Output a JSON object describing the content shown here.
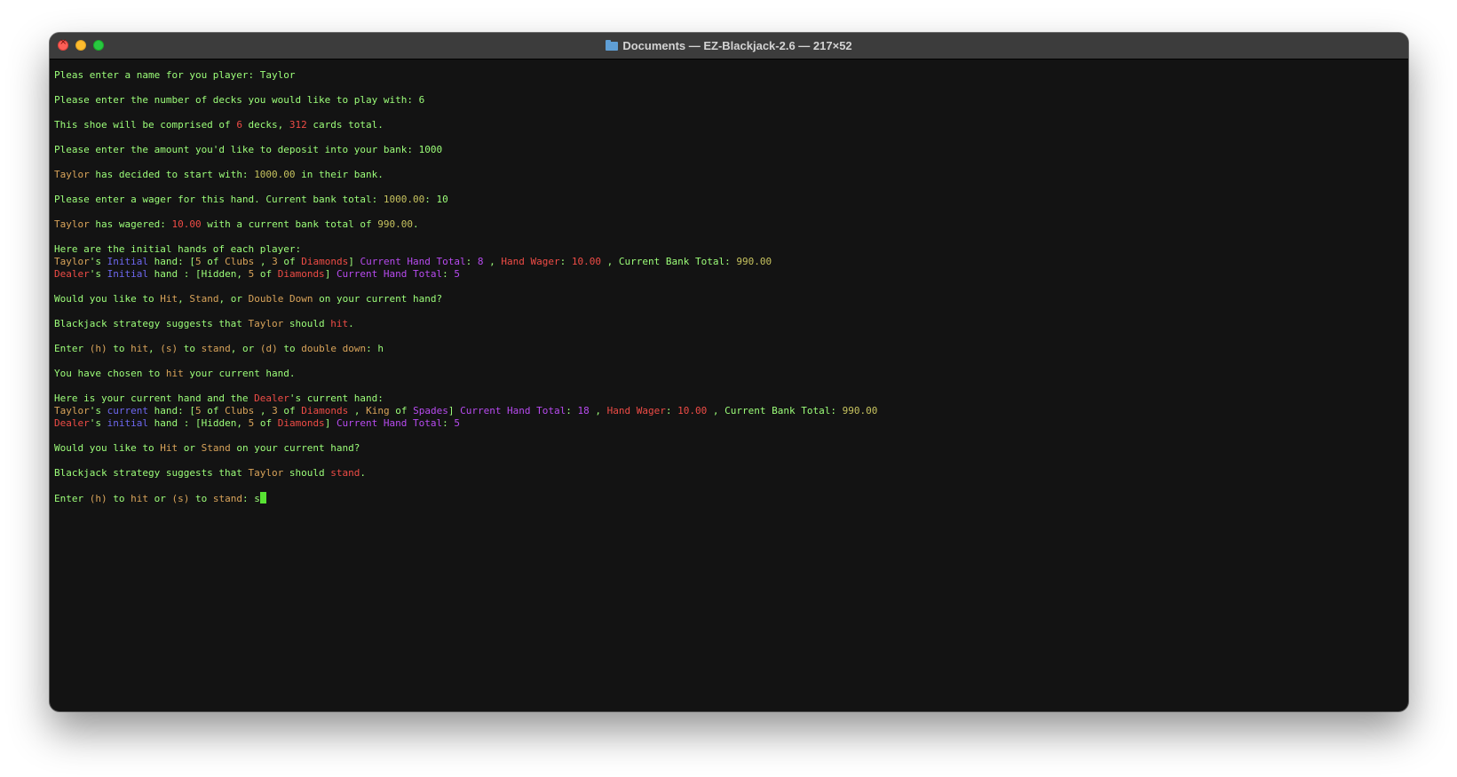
{
  "window": {
    "title": "Documents — EZ-Blackjack-2.6 — 217×52"
  },
  "colors": {
    "default": "#9dff7a",
    "orange": "#d9a45a",
    "red": "#ef4c46",
    "purple": "#b84bf0",
    "blue": "#6e68f0",
    "gold": "#c7c35f",
    "cursor": "#58e233"
  },
  "terminal": {
    "lines": [
      [
        [
          "Pleas enter a name for you player: Taylor",
          "default"
        ]
      ],
      [],
      [
        [
          "Please enter the number of decks you would like to play with: 6",
          "default"
        ]
      ],
      [],
      [
        [
          "This shoe will be comprised of ",
          "default"
        ],
        [
          "6",
          "red"
        ],
        [
          " decks, ",
          "default"
        ],
        [
          "312",
          "red"
        ],
        [
          " cards total.",
          "default"
        ]
      ],
      [],
      [
        [
          "Please enter the amount you'd like to deposit into your bank: 1000",
          "default"
        ]
      ],
      [],
      [
        [
          "Taylor",
          "orange"
        ],
        [
          " has decided to start with: ",
          "default"
        ],
        [
          "1000.00",
          "gold"
        ],
        [
          " in their bank.",
          "default"
        ]
      ],
      [],
      [
        [
          "Please enter a wager for this hand. Current bank total: ",
          "default"
        ],
        [
          "1000.00",
          "gold"
        ],
        [
          ": 10",
          "default"
        ]
      ],
      [],
      [
        [
          "Taylor",
          "orange"
        ],
        [
          " has wagered: ",
          "default"
        ],
        [
          "10.00",
          "red"
        ],
        [
          " with a current bank total of ",
          "default"
        ],
        [
          "990.00",
          "gold"
        ],
        [
          ".",
          "default"
        ]
      ],
      [],
      [
        [
          "Here are the initial hands of each player:",
          "default"
        ]
      ],
      [
        [
          "Taylor",
          "orange"
        ],
        [
          "'s ",
          "default"
        ],
        [
          "Initial",
          "blue"
        ],
        [
          " hand: [",
          "default"
        ],
        [
          "5",
          "orange"
        ],
        [
          " of ",
          "default"
        ],
        [
          "Clubs",
          "orange"
        ],
        [
          " , ",
          "default"
        ],
        [
          "3",
          "orange"
        ],
        [
          " of ",
          "default"
        ],
        [
          "Diamonds",
          "red"
        ],
        [
          "] ",
          "default"
        ],
        [
          "Current Hand Total",
          "purple"
        ],
        [
          ": ",
          "default"
        ],
        [
          "8",
          "purple"
        ],
        [
          " , ",
          "default"
        ],
        [
          "Hand Wager",
          "red"
        ],
        [
          ": ",
          "default"
        ],
        [
          "10.00",
          "red"
        ],
        [
          " , ",
          "default"
        ],
        [
          "Current Bank Total",
          "default"
        ],
        [
          ": ",
          "default"
        ],
        [
          "990.00",
          "gold"
        ]
      ],
      [
        [
          "Dealer",
          "red"
        ],
        [
          "'s ",
          "default"
        ],
        [
          "Initial",
          "blue"
        ],
        [
          " hand : [Hidden, ",
          "default"
        ],
        [
          "5",
          "orange"
        ],
        [
          " of ",
          "default"
        ],
        [
          "Diamonds",
          "red"
        ],
        [
          "] ",
          "default"
        ],
        [
          "Current Hand Total",
          "purple"
        ],
        [
          ": ",
          "default"
        ],
        [
          "5",
          "purple"
        ]
      ],
      [],
      [
        [
          "Would you like to ",
          "default"
        ],
        [
          "Hit",
          "orange"
        ],
        [
          ", ",
          "default"
        ],
        [
          "Stand",
          "orange"
        ],
        [
          ", or ",
          "default"
        ],
        [
          "Double Down",
          "orange"
        ],
        [
          " on your current hand?",
          "default"
        ]
      ],
      [],
      [
        [
          "Blackjack strategy suggests that ",
          "default"
        ],
        [
          "Taylor",
          "orange"
        ],
        [
          " should ",
          "default"
        ],
        [
          "hit",
          "red"
        ],
        [
          ".",
          "default"
        ]
      ],
      [],
      [
        [
          "Enter ",
          "default"
        ],
        [
          "(h)",
          "orange"
        ],
        [
          " to ",
          "default"
        ],
        [
          "hit",
          "orange"
        ],
        [
          ", ",
          "default"
        ],
        [
          "(s)",
          "orange"
        ],
        [
          " to ",
          "default"
        ],
        [
          "stand",
          "orange"
        ],
        [
          ", or ",
          "default"
        ],
        [
          "(d)",
          "orange"
        ],
        [
          " to ",
          "default"
        ],
        [
          "double down",
          "orange"
        ],
        [
          ": h",
          "default"
        ]
      ],
      [],
      [
        [
          "You have chosen to ",
          "default"
        ],
        [
          "hit",
          "orange"
        ],
        [
          " your current hand.",
          "default"
        ]
      ],
      [],
      [
        [
          "Here is your current hand and the ",
          "default"
        ],
        [
          "Dealer",
          "red"
        ],
        [
          "'s current hand:",
          "default"
        ]
      ],
      [
        [
          "Taylor",
          "orange"
        ],
        [
          "'s ",
          "default"
        ],
        [
          "current",
          "blue"
        ],
        [
          " hand: [",
          "default"
        ],
        [
          "5",
          "orange"
        ],
        [
          " of ",
          "default"
        ],
        [
          "Clubs",
          "orange"
        ],
        [
          " , ",
          "default"
        ],
        [
          "3",
          "orange"
        ],
        [
          " of ",
          "default"
        ],
        [
          "Diamonds",
          "red"
        ],
        [
          " , ",
          "default"
        ],
        [
          "King",
          "orange"
        ],
        [
          " of ",
          "default"
        ],
        [
          "Spades",
          "purple"
        ],
        [
          "] ",
          "default"
        ],
        [
          "Current Hand Total",
          "purple"
        ],
        [
          ": ",
          "default"
        ],
        [
          "18",
          "purple"
        ],
        [
          " , ",
          "default"
        ],
        [
          "Hand Wager",
          "red"
        ],
        [
          ": ",
          "default"
        ],
        [
          "10.00",
          "red"
        ],
        [
          " , ",
          "default"
        ],
        [
          "Current Bank Total",
          "default"
        ],
        [
          ": ",
          "default"
        ],
        [
          "990.00",
          "gold"
        ]
      ],
      [
        [
          "Dealer",
          "red"
        ],
        [
          "'s ",
          "default"
        ],
        [
          "initial",
          "blue"
        ],
        [
          " hand : [Hidden, ",
          "default"
        ],
        [
          "5",
          "orange"
        ],
        [
          " of ",
          "default"
        ],
        [
          "Diamonds",
          "red"
        ],
        [
          "] ",
          "default"
        ],
        [
          "Current Hand Total",
          "purple"
        ],
        [
          ": ",
          "default"
        ],
        [
          "5",
          "purple"
        ]
      ],
      [],
      [
        [
          "Would you like to ",
          "default"
        ],
        [
          "Hit",
          "orange"
        ],
        [
          " or ",
          "default"
        ],
        [
          "Stand",
          "orange"
        ],
        [
          " on your current hand?",
          "default"
        ]
      ],
      [],
      [
        [
          "Blackjack strategy suggests that ",
          "default"
        ],
        [
          "Taylor",
          "orange"
        ],
        [
          " should ",
          "default"
        ],
        [
          "stand",
          "red"
        ],
        [
          ".",
          "default"
        ]
      ],
      [],
      [
        [
          "Enter ",
          "default"
        ],
        [
          "(h)",
          "orange"
        ],
        [
          " to ",
          "default"
        ],
        [
          "hit",
          "orange"
        ],
        [
          " or ",
          "default"
        ],
        [
          "(s)",
          "orange"
        ],
        [
          " to ",
          "default"
        ],
        [
          "stand",
          "orange"
        ],
        [
          ": s",
          "default"
        ]
      ]
    ]
  }
}
